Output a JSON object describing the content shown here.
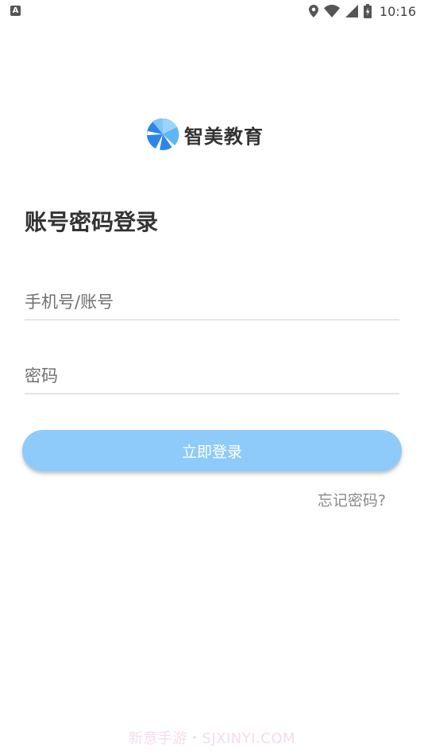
{
  "status_bar": {
    "notification_icon_letter": "A",
    "time": "10:16",
    "icons": [
      "location-icon",
      "wifi-icon",
      "signal-icon",
      "battery-charging-icon"
    ]
  },
  "logo": {
    "text": "智美教育",
    "brand_colors": [
      "#2b86e8",
      "#5fb6f5",
      "#9bd4fb"
    ]
  },
  "page": {
    "title": "账号密码登录"
  },
  "form": {
    "account_placeholder": "手机号/账号",
    "account_value": "",
    "password_placeholder": "密码",
    "password_value": "",
    "login_label": "立即登录",
    "forgot_label": "忘记密码?"
  },
  "colors": {
    "button_bg": "#8ecbfa",
    "text_primary": "#333333",
    "text_secondary": "#8a8a8a"
  },
  "watermark": {
    "text": "新意手游・SJXINYI.COM"
  }
}
